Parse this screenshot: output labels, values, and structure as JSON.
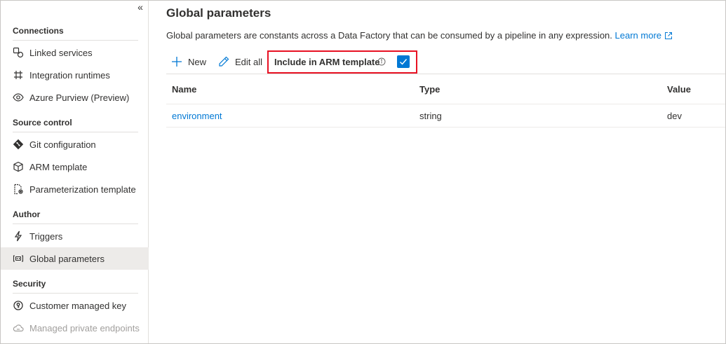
{
  "sidebar": {
    "collapse_glyph": "«",
    "sections": [
      {
        "header": "Connections",
        "items": [
          {
            "label": "Linked services",
            "icon": "linked-services-icon"
          },
          {
            "label": "Integration runtimes",
            "icon": "integration-runtime-icon"
          },
          {
            "label": "Azure Purview (Preview)",
            "icon": "eye-icon"
          }
        ]
      },
      {
        "header": "Source control",
        "items": [
          {
            "label": "Git configuration",
            "icon": "git-icon"
          },
          {
            "label": "ARM template",
            "icon": "cube-icon"
          },
          {
            "label": "Parameterization template",
            "icon": "document-gear-icon"
          }
        ]
      },
      {
        "header": "Author",
        "items": [
          {
            "label": "Triggers",
            "icon": "lightning-icon"
          },
          {
            "label": "Global parameters",
            "icon": "brackets-icon",
            "selected": true
          }
        ]
      },
      {
        "header": "Security",
        "items": [
          {
            "label": "Customer managed key",
            "icon": "key-icon"
          },
          {
            "label": "Managed private endpoints",
            "icon": "cloud-link-icon",
            "disabled": true
          }
        ]
      }
    ]
  },
  "main": {
    "title": "Global parameters",
    "description": "Global parameters are constants across a Data Factory that can be consumed by a pipeline in any expression.",
    "learn_more": "Learn more",
    "toolbar": {
      "new_label": "New",
      "edit_all_label": "Edit all",
      "arm_label": "Include in ARM template",
      "arm_checked": true
    },
    "table": {
      "columns": [
        "Name",
        "Type",
        "Value"
      ],
      "rows": [
        {
          "name": "environment",
          "type": "string",
          "value": "dev"
        }
      ]
    }
  },
  "colors": {
    "accent": "#0078d4",
    "highlight_border": "#e81123",
    "selected_bg": "#edebe9"
  }
}
